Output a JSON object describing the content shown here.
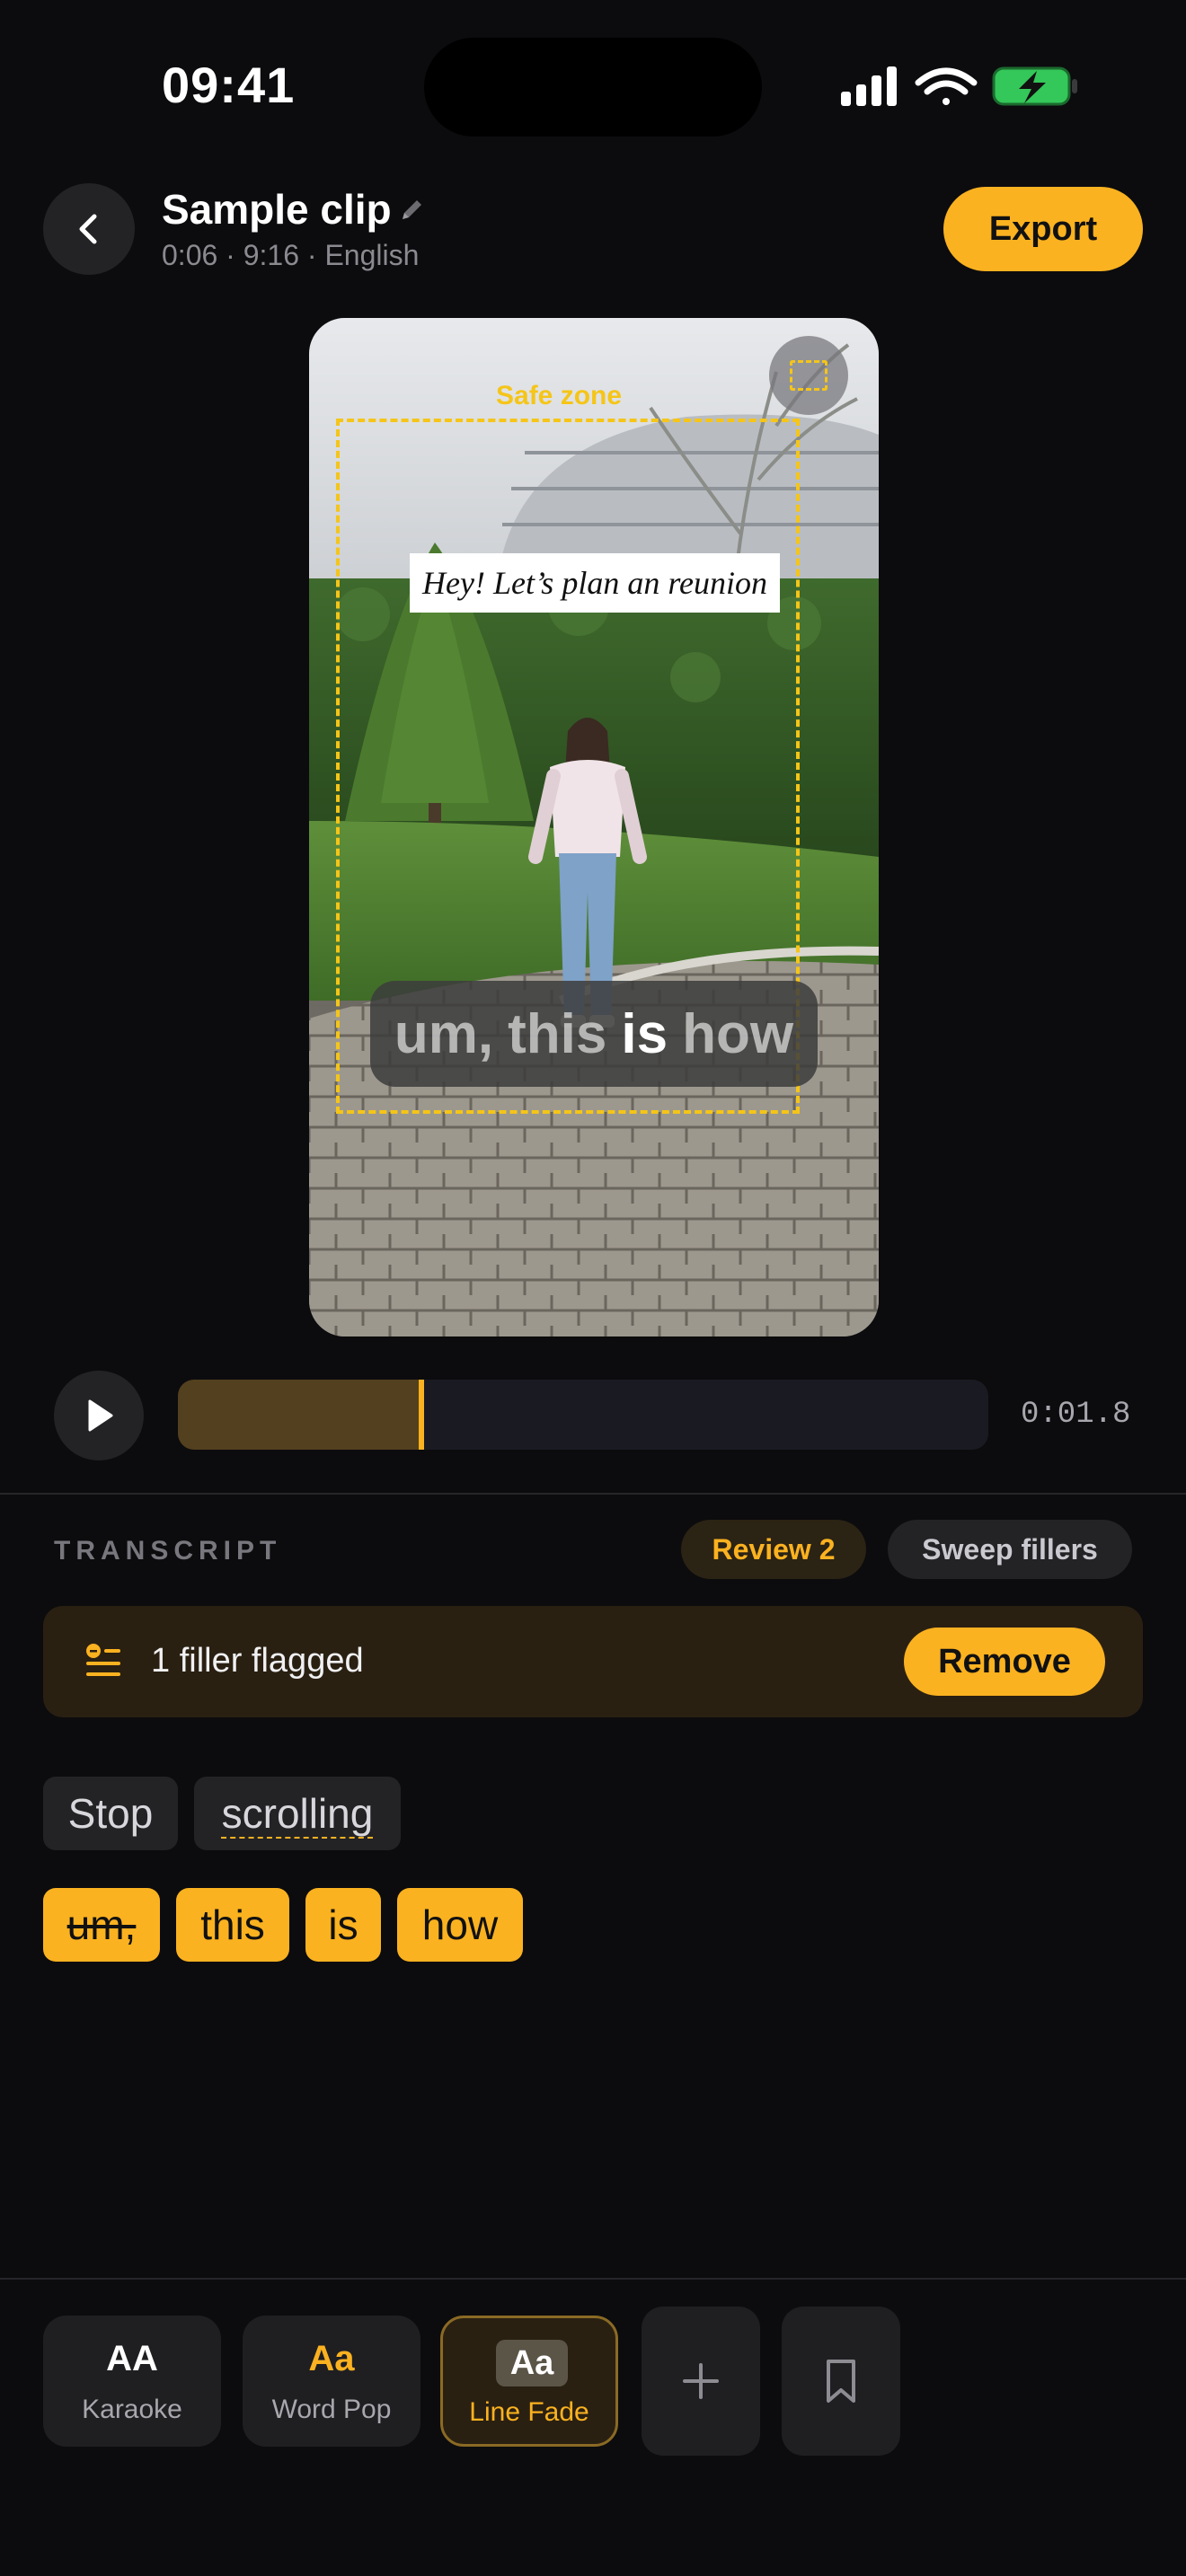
{
  "status_bar": {
    "time": "09:41"
  },
  "header": {
    "title": "Sample clip",
    "subtitle": "0:06 · 9:16 · English",
    "export_label": "Export"
  },
  "preview": {
    "safe_zone_label": "Safe zone",
    "headline": "Hey! Let’s plan an reunion",
    "caption_words": [
      "um,",
      "this",
      "is",
      "how"
    ],
    "active_word": "is"
  },
  "timeline": {
    "time": "0:01.8",
    "progress": 0.3
  },
  "transcript": {
    "section_label": "TRANSCRIPT",
    "review_label": "Review 2",
    "sweep_label": "Sweep fillers",
    "filler_banner": {
      "text": "1 filler flagged",
      "remove_label": "Remove"
    },
    "lines": [
      [
        {
          "text": "Stop",
          "style": "plain"
        },
        {
          "text": "scrolling",
          "style": "plain-flagged"
        }
      ],
      [
        {
          "text": "um,",
          "style": "highlight-struck"
        },
        {
          "text": "this",
          "style": "highlight"
        },
        {
          "text": "is",
          "style": "highlight"
        },
        {
          "text": "how",
          "style": "highlight"
        }
      ]
    ]
  },
  "caption_styles": [
    {
      "sample": "AA",
      "name": "Karaoke",
      "sample_color": "#ffffff"
    },
    {
      "sample": "Aa",
      "name": "Word Pop",
      "sample_color": "#fbb220"
    },
    {
      "sample": "Aa",
      "name": "Line Fade",
      "selected": true
    }
  ],
  "icons": [
    "back-chevron-icon",
    "pencil-icon",
    "play-icon",
    "filler-list-icon",
    "plus-icon",
    "bookmark-icon",
    "safe-zone-icon"
  ],
  "colors": {
    "accent": "#fbb220",
    "background": "#0c0c0e",
    "safe_zone": "#f5c518"
  }
}
